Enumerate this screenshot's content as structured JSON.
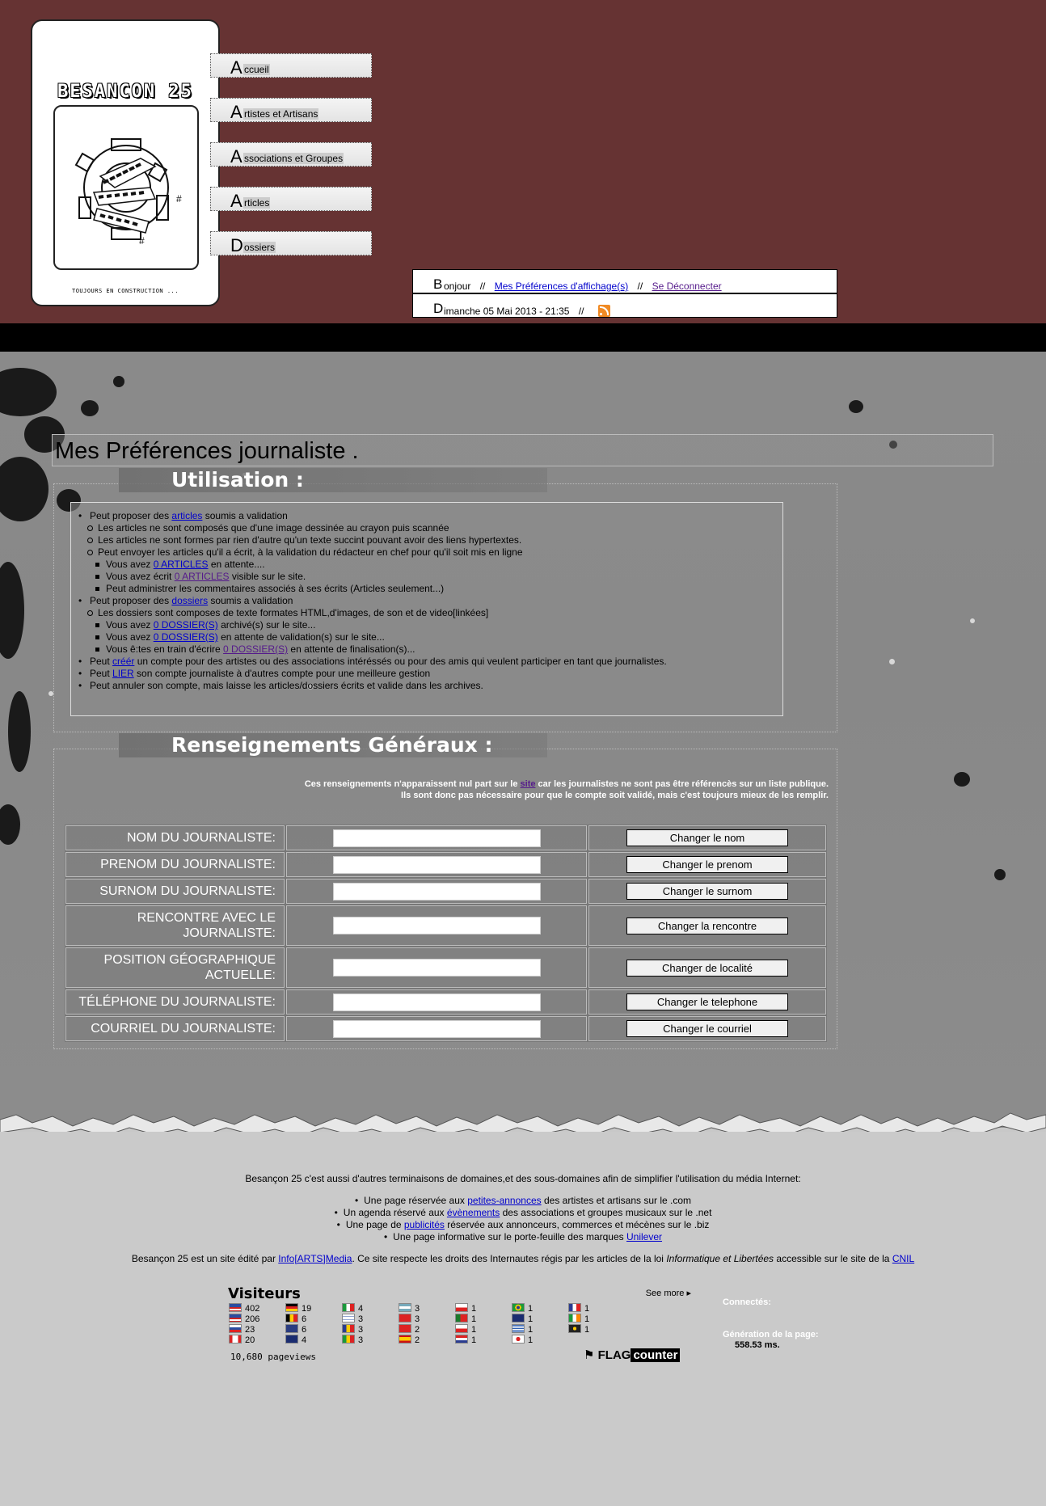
{
  "logo": {
    "title": "BESANCON 25",
    "caption": "TOUJOURS EN CONSTRUCTION ..."
  },
  "nav": [
    {
      "cap": "A",
      "rest": "ccueil"
    },
    {
      "cap": "A",
      "rest": "rtistes et Artisans"
    },
    {
      "cap": "A",
      "rest": "ssociations et Groupes"
    },
    {
      "cap": "A",
      "rest": "rticles"
    },
    {
      "cap": "D",
      "rest": "ossiers"
    }
  ],
  "infobar": {
    "greeting_cap": "B",
    "greeting_rest": "onjour",
    "sep": "//",
    "prefs_link": "Mes Préférences d'affichage(s)",
    "logout_link": "Se Déconnecter",
    "date_cap": "D",
    "date_rest": "imanche 05 Mai 2013 - 21:35",
    "rss_icon": "rss-icon"
  },
  "page_title": "Mes Préférences journaliste .",
  "usage": {
    "title": "Utilisation :",
    "l1_pre": "Peut proposer des ",
    "l1_link": "articles",
    "l1_post": " soumis a validation",
    "l1a": "Les articles ne sont composés que d'une image dessinée au crayon puis scannée",
    "l1b": "Les articles ne sont formes par rien d'autre qu'un texte succint pouvant avoir des liens hypertextes.",
    "l1c": "Peut envoyer les articles qu'il a écrit, à la validation du rédacteur en chef pour qu'il soit mis en ligne",
    "l1c1_pre": "Vous avez ",
    "l1c1_link": "0 ARTICLES",
    "l1c1_post": " en attente....",
    "l1c2_pre": "Vous avez écrit ",
    "l1c2_link": "0 ARTICLES",
    "l1c2_post": " visible sur le site.",
    "l1c3": "Peut administrer les commentaires associés à ses écrits (Articles seulement...)",
    "l2_pre": "Peut proposer des ",
    "l2_link": "dossiers",
    "l2_post": " soumis a validation",
    "l2a": "Les dossiers sont composes de texte formates HTML,d'images, de son et de video[linkées]",
    "l2a1_pre": "Vous avez ",
    "l2a1_link": "0 DOSSIER(S)",
    "l2a1_post": " archivé(s) sur le site...",
    "l2a2_pre": "Vous avez ",
    "l2a2_link": "0 DOSSIER(S)",
    "l2a2_post": " en attente de validation(s) sur le site...",
    "l2a3_pre": "Vous ê:tes en train d'écrire ",
    "l2a3_link": "0 DOSSIER(S)",
    "l2a3_post": " en attente de finalisation(s)...",
    "l3_pre": "Peut ",
    "l3_link": "créér",
    "l3_post": " un compte pour des artistes ou des associations intéréssés ou pour des amis qui veulent participer en tant que journalistes.",
    "l4_pre": "Peut ",
    "l4_link": "LIER",
    "l4_post": " son compte journaliste à d'autres compte pour une meilleure gestion",
    "l5": "Peut annuler son compte, mais laisse les articles/dossiers écrits et valide dans les archives."
  },
  "renseignements": {
    "title": "Renseignements Généraux :",
    "note1_pre": "Ces renseignements n'apparaissent nul part sur le ",
    "note1_link": "site",
    "note1_post": " car les journalistes ne sont pas être référencès sur un liste publique.",
    "note2": "Ils sont donc pas nécessaire pour que le compte soit validé, mais c'est toujours mieux de les remplir.",
    "rows": [
      {
        "label": "NOM DU JOURNALISTE:",
        "value": "",
        "button": "Changer le nom"
      },
      {
        "label": "PRENOM DU JOURNALISTE:",
        "value": "",
        "button": "Changer le prenom"
      },
      {
        "label": "SURNOM DU JOURNALISTE:",
        "value": "",
        "button": "Changer le surnom"
      },
      {
        "label": "RENCONTRE AVEC LE JOURNALISTE:",
        "value": "",
        "button": "Changer la rencontre"
      },
      {
        "label": "POSITION GÉOGRAPHIQUE ACTUELLE:",
        "value": "",
        "button": "Changer de localité"
      },
      {
        "label": "TÉLÉPHONE DU JOURNALISTE:",
        "value": "",
        "button": "Changer le telephone"
      },
      {
        "label": "COURRIEL DU JOURNALISTE:",
        "value": "",
        "button": "Changer le courriel"
      }
    ]
  },
  "footer": {
    "intro": "Besançon 25 c'est aussi d'autres terminaisons de domaines,et des sous-domaines afin de simplifier l'utilisation du média Internet:",
    "i1_pre": "Une page réservée aux ",
    "i1_link": "petites-annonces",
    "i1_post": " des artistes et artisans sur le .com",
    "i2_pre": "Un agenda réservé aux ",
    "i2_link": "évènements",
    "i2_post": " des associations et groupes musicaux sur le .net",
    "i3_pre": "Une page de ",
    "i3_link": "publicités",
    "i3_post": " réservée aux annonceurs, commerces et mécènes sur le .biz",
    "i4_pre": "Une page informative sur le porte-feuille des marques ",
    "i4_link": "Unilever",
    "legal_pre": "Besançon 25 est un site édité par ",
    "legal_link": "Info[ARTS]Media",
    "legal_mid": ". Ce site respecte les droits des Internautes régis par les articles de la loi ",
    "legal_em": "Informatique et Libertées",
    "legal_mid2": " accessible sur le site de la ",
    "legal_link2": "CNIL"
  },
  "flagcounter": {
    "title": "Visiteurs",
    "see_more": "See more",
    "pageviews": "10,680 pageviews",
    "logo_flag": "FLAG",
    "logo_counter": "counter",
    "columns": [
      [
        "402",
        "206",
        "23",
        "20"
      ],
      [
        "19",
        "6",
        "6",
        "4"
      ],
      [
        "4",
        "3",
        "3",
        "3"
      ],
      [
        "3",
        "3",
        "2",
        "2"
      ],
      [
        "1",
        "1",
        "1",
        "1"
      ],
      [
        "1",
        "1",
        "1",
        "1"
      ],
      [
        "1",
        "1",
        "1"
      ]
    ]
  },
  "stats": {
    "connected_label": "Connectés:",
    "generation_label": "Génération de la page:",
    "generation_value": "558.53 ms."
  }
}
